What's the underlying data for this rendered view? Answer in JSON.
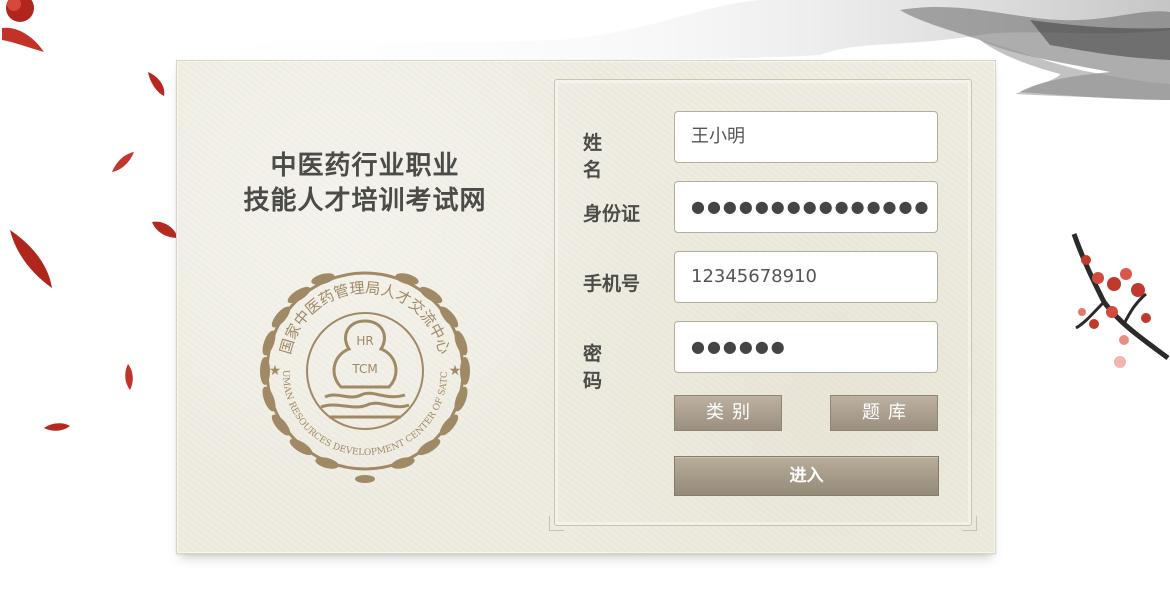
{
  "site": {
    "title_line1": "中医药行业职业",
    "title_line2": "技能人才培训考试网"
  },
  "seal": {
    "org_name_cn": "国家中医药管理局人才交流中心",
    "org_name_en": "HUMAN RESOURCES DEVELOPMENT CENTER OF SATCM",
    "logo_top": "HR",
    "logo_bottom": "TCM"
  },
  "form": {
    "name": {
      "label": "姓名",
      "value": "王小明"
    },
    "id_card": {
      "label": "身份证",
      "value": "●●●●●●●●●●●●●●●"
    },
    "phone": {
      "label": "手机号",
      "value": "12345678910"
    },
    "password": {
      "label": "密码",
      "value": "●●●●●●"
    }
  },
  "buttons": {
    "category": "类别",
    "question_bank": "题库",
    "enter": "进入"
  },
  "colors": {
    "card_bg": "#efede2",
    "text_dark": "#4b4b48",
    "button_brown": "#a39885",
    "seal_gold": "#a08a66",
    "plum_red": "#c0392b"
  },
  "icons": [
    "ink-mountain-decoration",
    "plum-blossom-branch",
    "falling-petal",
    "hr-tcm-seal"
  ]
}
